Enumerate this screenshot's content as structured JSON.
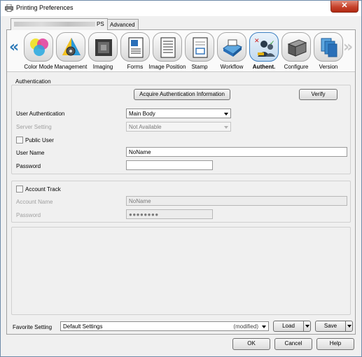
{
  "window": {
    "title": "Printing Preferences",
    "close_label": "✕"
  },
  "tabs": [
    {
      "label": "PS"
    },
    {
      "label": "Advanced"
    }
  ],
  "toolbar": {
    "left_arrow": "«",
    "right_arrow": "»",
    "items": [
      {
        "label": "Color Mode",
        "icon": "color-mode-icon"
      },
      {
        "label": "Management",
        "icon": "management-icon"
      },
      {
        "label": "Imaging",
        "icon": "imaging-icon"
      },
      {
        "label": "Forms",
        "icon": "forms-icon"
      },
      {
        "label": "Image Position",
        "icon": "image-position-icon"
      },
      {
        "label": "Stamp",
        "icon": "stamp-icon"
      },
      {
        "label": "Workflow",
        "icon": "workflow-icon"
      },
      {
        "label": "Authent.",
        "icon": "authentication-icon",
        "selected": true
      },
      {
        "label": "Configure",
        "icon": "configure-icon"
      },
      {
        "label": "Version",
        "icon": "version-icon"
      }
    ]
  },
  "authentication": {
    "group_title": "Authentication",
    "acquire_button": "Acquire Authentication Information",
    "verify_button": "Verify",
    "user_auth_label": "User Authentication",
    "user_auth_value": "Main Body",
    "server_setting_label": "Server Setting",
    "server_setting_value": "Not Available",
    "public_user_label": "Public User",
    "user_name_label": "User Name",
    "user_name_value": "NoName",
    "password_label": "Password",
    "password_value": ""
  },
  "account_track": {
    "checkbox_label": "Account Track",
    "account_name_label": "Account Name",
    "account_name_value": "NoName",
    "password_label": "Password",
    "password_value": "●●●●●●●●"
  },
  "favorite": {
    "label": "Favorite Setting",
    "value": "Default Settings",
    "modified": "(modified)",
    "load_button": "Load",
    "save_button": "Save"
  },
  "dialog_buttons": {
    "ok": "OK",
    "cancel": "Cancel",
    "help": "Help"
  },
  "colors": {
    "accent": "#3c7fc0",
    "close": "#c7432c"
  }
}
